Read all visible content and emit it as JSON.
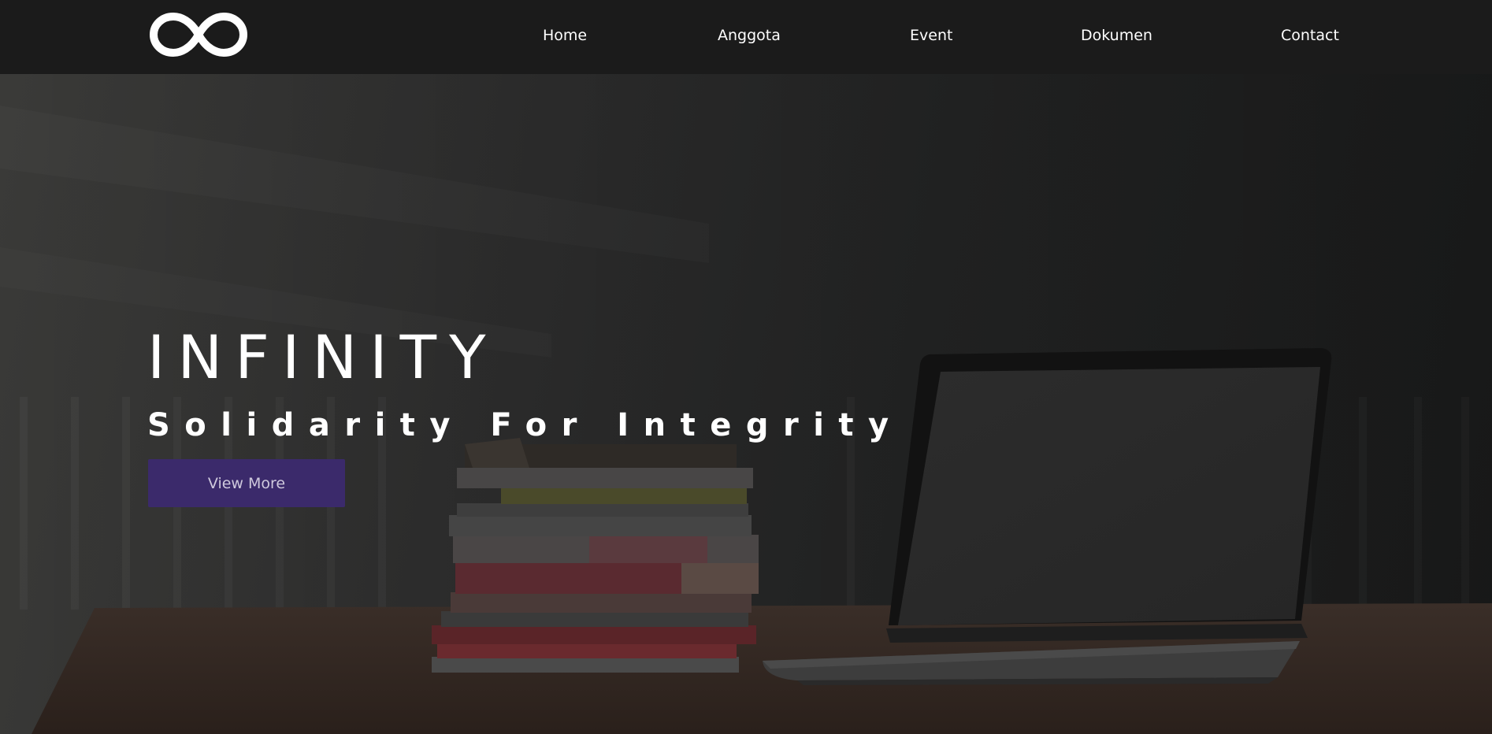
{
  "nav": {
    "logo_icon": "infinity-icon",
    "links": [
      "Home",
      "Anggota",
      "Event",
      "Dokumen",
      "Contact"
    ]
  },
  "hero": {
    "title": "INFINITY",
    "subtitle": "Solidarity For Integrity",
    "button_label": "View More"
  },
  "colors": {
    "navbar": "#1b1b1b",
    "button": "#3b2a6b",
    "text": "#ffffff"
  }
}
